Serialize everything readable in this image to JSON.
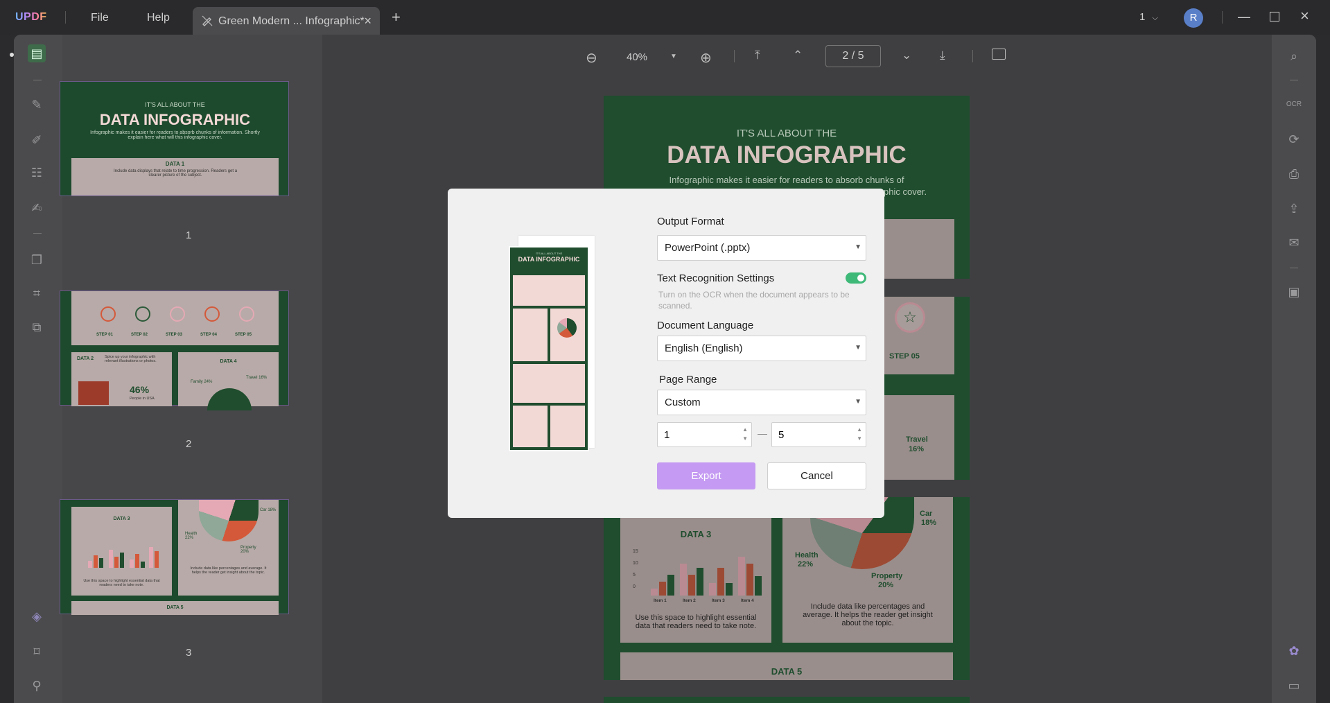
{
  "app": {
    "logo": "UPDF",
    "menu": [
      "File",
      "Help"
    ],
    "tab_title": "Green Modern ... Infographic*",
    "window_count": "1",
    "avatar_letter": "R"
  },
  "toolbar": {
    "zoom": "40%",
    "page_current": "2",
    "page_sep": "/",
    "page_total": "5"
  },
  "thumbnails": {
    "page_labels": [
      "1",
      "2",
      "3"
    ],
    "p1": {
      "kicker": "IT'S ALL ABOUT THE",
      "title": "DATA INFOGRAPHIC",
      "desc": "Infographic makes it easier for readers to absorb chunks of information. Shortly explain here what will this infographic cover.",
      "data1": "DATA 1",
      "data1_desc": "Include data displays that relate to time progression. Readers get a clearer picture of the subject."
    },
    "p2": {
      "steps": [
        "STEP 01",
        "STEP 02",
        "STEP 03",
        "STEP 04",
        "STEP 05"
      ],
      "data2": "DATA 2",
      "data2_desc": "Spice up your infographic with relevant illustrations or photos.",
      "stat": "46%",
      "stat_desc": "People in USA",
      "data4": "DATA 4",
      "family": "Family 24%",
      "travel": "Travel 16%"
    },
    "p3": {
      "data3": "DATA 3",
      "data3_desc": "Use this space to highlight essential data that readers need to take note.",
      "car": "Car 18%",
      "health": "Health 22%",
      "property": "Property 20%",
      "pie_desc": "Include data like percentages and average. It helps the reader get insight about the topic.",
      "data5": "DATA 5"
    }
  },
  "page": {
    "kicker": "IT'S ALL ABOUT THE",
    "title": "DATA INFOGRAPHIC",
    "desc_line1": "Infographic makes it easier for readers to absorb chunks of",
    "desc_line2_tail": "phic cover.",
    "step05": "STEP 05",
    "travel": "Travel",
    "travel_pct": "16%",
    "data3": "DATA 3",
    "y_ticks": [
      "15",
      "10",
      "5",
      "0"
    ],
    "items": [
      "Item 1",
      "Item 2",
      "Item 3",
      "Item 4"
    ],
    "data3_desc": "Use this space to highlight essential data that readers need to take note.",
    "car": "Car",
    "car_pct": "18%",
    "health": "Health",
    "health_pct": "22%",
    "property": "Property",
    "property_pct": "20%",
    "pie_desc": "Include data like percentages and average. It helps the reader get insight about the topic.",
    "data5": "DATA 5"
  },
  "dialog": {
    "output_format_label": "Output Format",
    "output_format_value": "PowerPoint (.pptx)",
    "ocr_label": "Text Recognition Settings",
    "ocr_hint": "Turn on the OCR when the document appears to be scanned.",
    "ocr_enabled": true,
    "language_label": "Document Language",
    "language_value": "English (English)",
    "range_label": "Page Range",
    "range_value": "Custom",
    "range_from": "1",
    "range_dash": "—",
    "range_to": "5",
    "export_label": "Export",
    "cancel_label": "Cancel",
    "preview_title": "DATA INFOGRAPHIC",
    "preview_kicker": "IT'S ALL ABOUT THE"
  },
  "colors": {
    "accent": "#c49af2",
    "toggle_on": "#3eb978",
    "infographic_green": "#1f4d2e",
    "infographic_pink": "#f3d9d6"
  }
}
